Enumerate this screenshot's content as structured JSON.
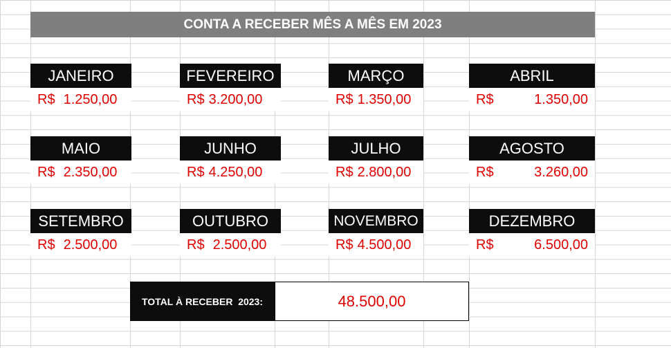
{
  "sheet": {
    "title": "CONTA A RECEBER MÊS A MÊS EM 2023",
    "currency": "R$",
    "months": [
      {
        "name": "JANEIRO",
        "value": "1.250,00"
      },
      {
        "name": "FEVEREIRO",
        "value": "3.200,00"
      },
      {
        "name": "MARÇO",
        "value": "1.350,00"
      },
      {
        "name": "ABRIL",
        "value": "1.350,00"
      },
      {
        "name": "MAIO",
        "value": "2.350,00"
      },
      {
        "name": "JUNHO",
        "value": "4.250,00"
      },
      {
        "name": "JULHO",
        "value": "2.800,00"
      },
      {
        "name": "AGOSTO",
        "value": "3.260,00"
      },
      {
        "name": "SETEMBRO",
        "value": "2.500,00"
      },
      {
        "name": "OUTUBRO",
        "value": "2.500,00"
      },
      {
        "name": "NOVEMBRO",
        "value": "4.500,00"
      },
      {
        "name": "DEZEMBRO",
        "value": "6.500,00"
      }
    ],
    "total_label": "TOTAL À RECEBER  2023:",
    "total_value": "48.500,00"
  },
  "colors": {
    "header_bg": "#0d0d0d",
    "title_bg": "#7f7f7f",
    "value_text": "#e00000",
    "gridline": "#d4d4d4"
  }
}
